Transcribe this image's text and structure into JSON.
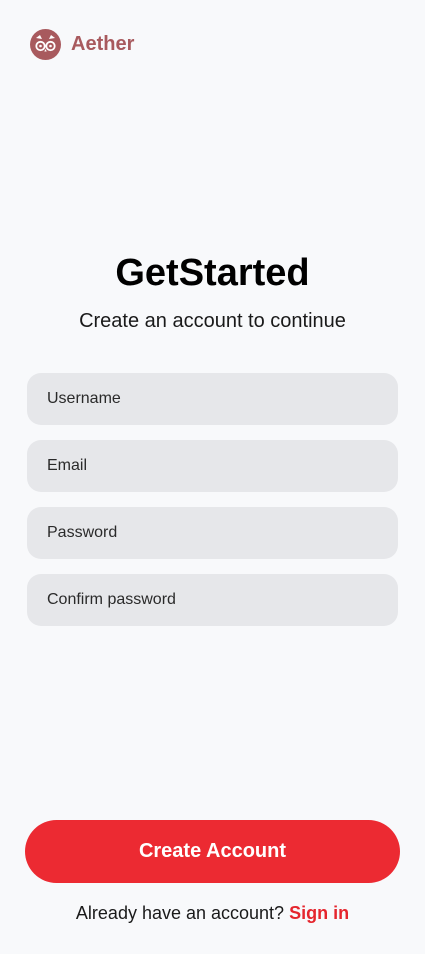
{
  "brand": {
    "name": "Aether",
    "logo_icon": "owl-icon",
    "color": "#a85a5e"
  },
  "heading": {
    "title": "GetStarted",
    "subtitle": "Create an account to continue"
  },
  "form": {
    "username_placeholder": "Username",
    "email_placeholder": "Email",
    "password_placeholder": "Password",
    "confirm_password_placeholder": "Confirm password"
  },
  "actions": {
    "create_account_label": "Create Account",
    "accent_color": "#ec2a32"
  },
  "footer": {
    "prompt": "Already have an account? ",
    "sign_in_label": "Sign in"
  }
}
